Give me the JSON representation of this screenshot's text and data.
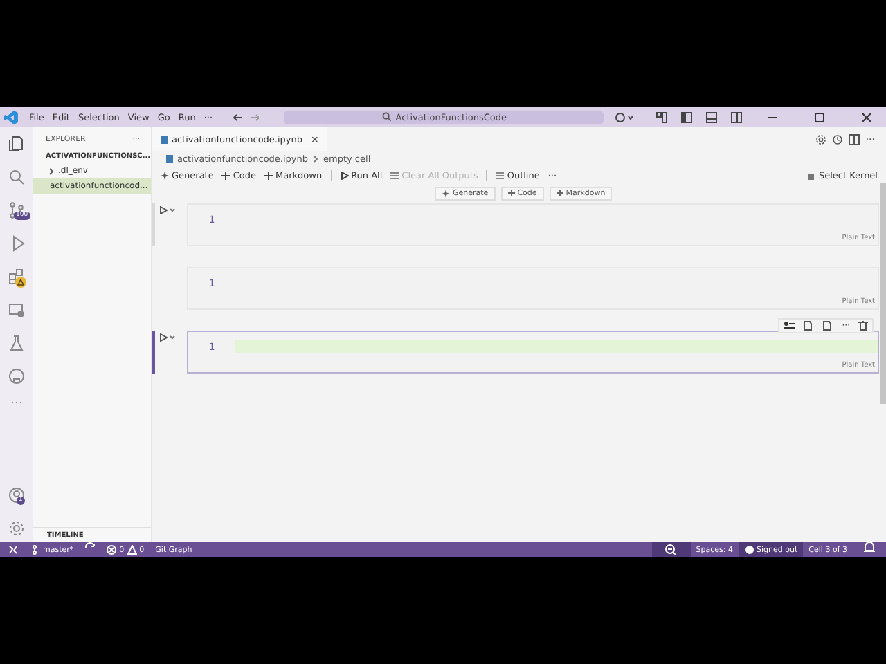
{
  "title_bar": {
    "menu": [
      "File",
      "Edit",
      "Selection",
      "View",
      "Go",
      "Run",
      "···"
    ],
    "search": "ActivationFunctionsCode"
  },
  "activity_bar": {
    "badges": [
      {
        "kind": "count",
        "text": "100"
      },
      {
        "kind": "warning"
      },
      {
        "kind": "count",
        "text": "1"
      }
    ]
  },
  "sidebar": {
    "title": "EXPLORER",
    "more": "···",
    "section": "ACTIVATIONFUNCTIONSC...",
    "items": [
      {
        "kind": "folder",
        "label": ".dl_env",
        "expanded": false,
        "selected": false
      },
      {
        "kind": "file",
        "label": "activationfunctioncod...",
        "selected": true
      }
    ],
    "footer": "TIMELINE"
  },
  "tab": {
    "label": "activationfunctioncode.ipynb",
    "close": "×"
  },
  "breadcrumb": [
    "activationfunctioncode.ipynb",
    "empty cell"
  ],
  "toolbar": [
    {
      "kind": "generate",
      "label": "Generate",
      "disabled": false
    },
    {
      "kind": "add",
      "label": "Code",
      "disabled": false
    },
    {
      "kind": "add",
      "label": "Markdown",
      "disabled": false
    },
    {
      "kind": "run",
      "label": "Run All",
      "disabled": false
    },
    {
      "kind": "clear",
      "label": "Clear All Outputs",
      "disabled": true
    },
    {
      "kind": "outline",
      "label": "Outline",
      "disabled": false
    },
    {
      "kind": "more",
      "label": "···",
      "disabled": false
    }
  ],
  "kernel": "Select Kernel",
  "insert_bar": [
    {
      "kind": "generate",
      "label": "Generate"
    },
    {
      "kind": "add",
      "label": "Code"
    },
    {
      "kind": "add",
      "label": "Markdown"
    }
  ],
  "cells": [
    {
      "line": "1",
      "language": "Plain Text",
      "selected": false,
      "run_button": true
    },
    {
      "line": "1",
      "language": "Plain Text",
      "selected": false,
      "run_button": false
    },
    {
      "line": "1",
      "language": "Plain Text",
      "selected": true,
      "run_button": true
    }
  ],
  "status_bar": {
    "branch": "master*",
    "errors": "0",
    "warnings": "0",
    "git_graph": "Git Graph",
    "spaces": "Spaces: 4",
    "account": "Signed out",
    "cell": "Cell 3 of 3"
  }
}
